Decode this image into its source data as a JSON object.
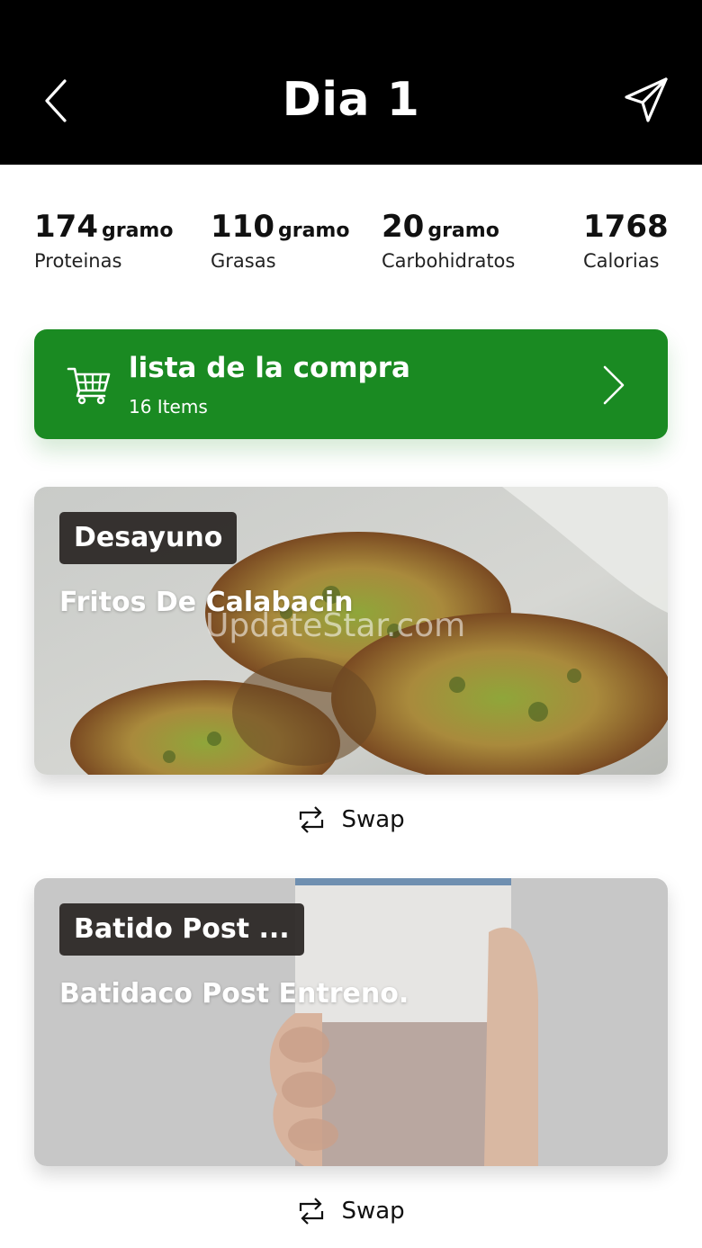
{
  "header": {
    "title": "Dia 1",
    "back_icon": "chevron-left-icon",
    "share_icon": "paper-plane-icon"
  },
  "macros": [
    {
      "value": "174",
      "unit": "gramo",
      "label": "Proteinas"
    },
    {
      "value": "110",
      "unit": "gramo",
      "label": "Grasas"
    },
    {
      "value": "20",
      "unit": "gramo",
      "label": "Carbohidratos"
    },
    {
      "value": "1768",
      "unit": "",
      "label": "Calorias"
    }
  ],
  "shopping_list": {
    "title": "lista de la compra",
    "subtitle": "16 Items",
    "icon": "cart-icon",
    "color": "#1a8a22"
  },
  "meals": [
    {
      "tag": "Desayuno",
      "name": "Fritos De Calabacin",
      "swap_label": "Swap"
    },
    {
      "tag": "Batido Post ...",
      "name": "Batidaco Post Entreno.",
      "swap_label": "Swap"
    }
  ],
  "watermark": "UpdateStar.com"
}
